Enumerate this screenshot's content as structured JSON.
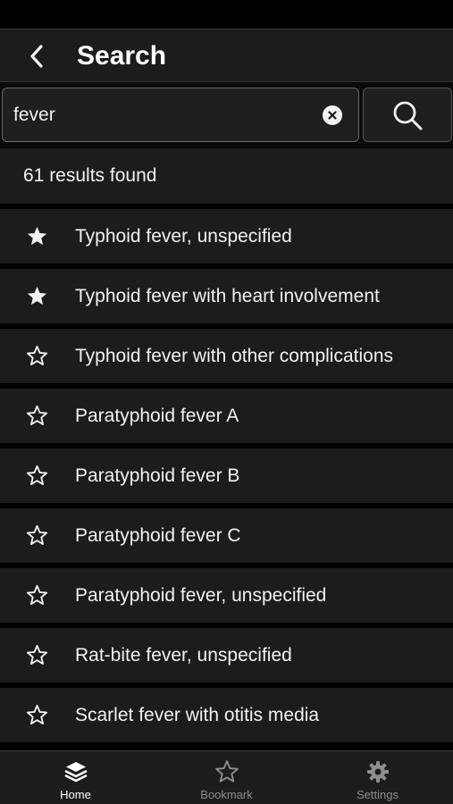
{
  "header": {
    "title": "Search"
  },
  "search": {
    "query": "fever",
    "placeholder": ""
  },
  "results": {
    "count_text": "61 results found",
    "items": [
      {
        "label": "Typhoid fever, unspecified",
        "bookmarked": true
      },
      {
        "label": "Typhoid fever with heart involvement",
        "bookmarked": true
      },
      {
        "label": "Typhoid fever with other complications",
        "bookmarked": false
      },
      {
        "label": "Paratyphoid fever A",
        "bookmarked": false
      },
      {
        "label": "Paratyphoid fever B",
        "bookmarked": false
      },
      {
        "label": "Paratyphoid fever C",
        "bookmarked": false
      },
      {
        "label": "Paratyphoid fever, unspecified",
        "bookmarked": false
      },
      {
        "label": "Rat-bite fever, unspecified",
        "bookmarked": false
      },
      {
        "label": "Scarlet fever with otitis media",
        "bookmarked": false
      }
    ]
  },
  "tabs": [
    {
      "label": "Home",
      "icon": "layers-icon",
      "active": true
    },
    {
      "label": "Bookmark",
      "icon": "star-icon",
      "active": false
    },
    {
      "label": "Settings",
      "icon": "gear-icon",
      "active": false
    }
  ],
  "colors": {
    "background": "#000000",
    "surface": "#1c1c1c",
    "text": "#f2f2f2",
    "inactive": "#8e8e8e"
  }
}
